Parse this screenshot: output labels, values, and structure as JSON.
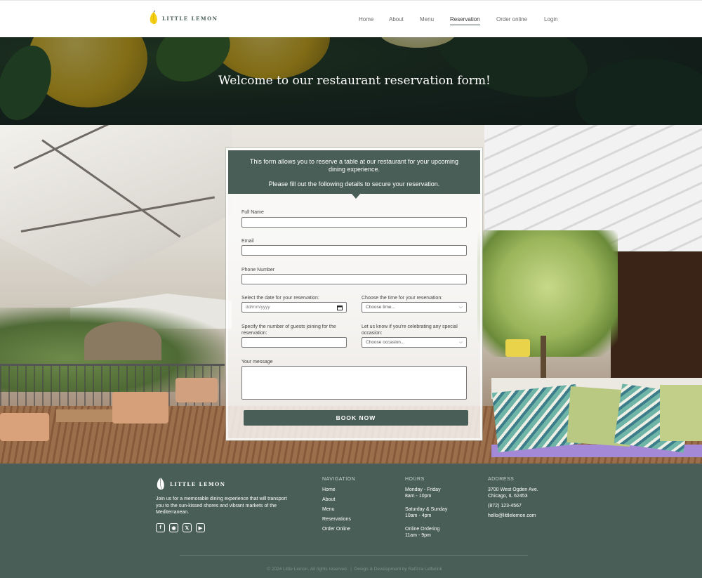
{
  "brand": {
    "name": "LITTLE LEMON"
  },
  "nav": {
    "items": [
      {
        "label": "Home"
      },
      {
        "label": "About"
      },
      {
        "label": "Menu"
      },
      {
        "label": "Reservation",
        "active": true
      },
      {
        "label": "Order online"
      },
      {
        "label": "Login"
      }
    ]
  },
  "hero": {
    "title": "Welcome to our restaurant reservation form!"
  },
  "form": {
    "intro": "This form allows you to reserve a table at our restaurant for your upcoming dining experience.",
    "instruction": "Please fill out the following details to secure your reservation.",
    "fields": {
      "full_name": {
        "label": "Full Name",
        "value": ""
      },
      "email": {
        "label": "Email",
        "value": ""
      },
      "phone": {
        "label": "Phone Number",
        "value": ""
      },
      "date": {
        "label": "Select the date for your reservation:",
        "placeholder": "dd/mm/yyyy"
      },
      "time": {
        "label": "Choose the time for your reservation:",
        "selected": "Choose time..."
      },
      "guests": {
        "label": "Specify the number of guests joining for the reservation:",
        "value": ""
      },
      "occasion": {
        "label": "Let us know if you're celebrating any special occasion:",
        "selected": "Choose occasion..."
      },
      "message": {
        "label": "Your message",
        "value": ""
      }
    },
    "submit_label": "BOOK NOW"
  },
  "footer": {
    "brand": "LITTLE LEMON",
    "description": "Join us for a memorable dining experience that will transport you to the sun-kissed shores and vibrant markets of the Mediterranean.",
    "social": [
      "facebook-icon",
      "instagram-icon",
      "x-icon",
      "youtube-icon"
    ],
    "navigation": {
      "title": "NAVIGATION",
      "items": [
        "Home",
        "About",
        "Menu",
        "Reservations",
        "Order Online"
      ]
    },
    "hours": {
      "title": "HOURS",
      "weekday_days": "Monday - Friday",
      "weekday_time": "8am - 10pm",
      "weekend_days": "Saturday & Sunday",
      "weekend_time": "10am - 4pm",
      "online_label": "Online Ordering",
      "online_time": "11am - 9pm"
    },
    "address": {
      "title": "ADDRESS",
      "street": "3700 West Ogden Ave.",
      "city": "Chicago, IL 62453",
      "phone": "(872) 123-4567",
      "email": "hello@littlelemon.com"
    },
    "copyright": "© 2024 Little Lemon. All rights reserved.",
    "separator": "|",
    "credit": "Design & Development by Rafizza Lefferink"
  },
  "colors": {
    "primary": "#495e57",
    "lemon": "#f4ce14"
  }
}
